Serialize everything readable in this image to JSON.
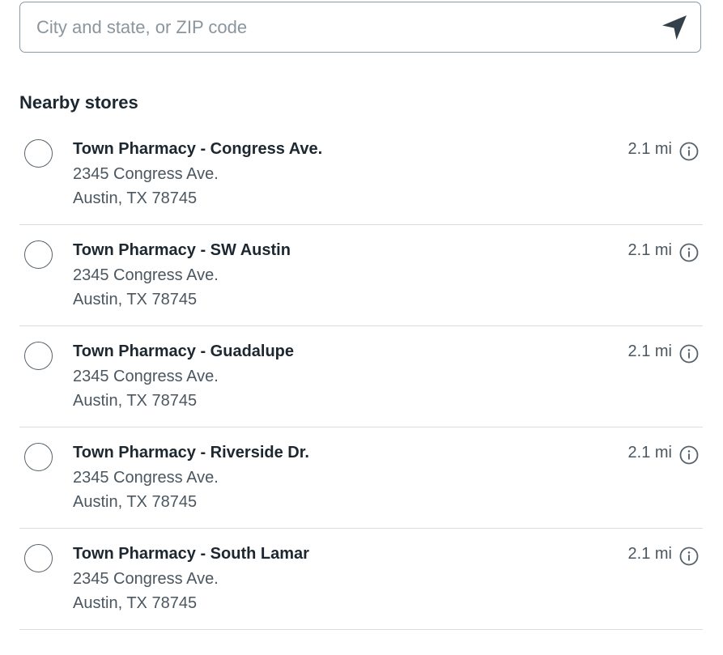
{
  "search": {
    "placeholder": "City and state, or ZIP code",
    "value": "",
    "locate_icon": "location-arrow-icon"
  },
  "nearby": {
    "title": "Nearby stores",
    "stores": [
      {
        "name": "Town Pharmacy - Congress Ave.",
        "address_line1": "2345 Congress Ave.",
        "address_line2": "Austin, TX 78745",
        "distance": "2.1 mi",
        "selected": false
      },
      {
        "name": "Town Pharmacy - SW Austin",
        "address_line1": "2345 Congress Ave.",
        "address_line2": "Austin, TX 78745",
        "distance": "2.1 mi",
        "selected": false
      },
      {
        "name": "Town Pharmacy - Guadalupe",
        "address_line1": "2345 Congress Ave.",
        "address_line2": "Austin, TX 78745",
        "distance": "2.1 mi",
        "selected": false
      },
      {
        "name": "Town Pharmacy - Riverside Dr.",
        "address_line1": "2345 Congress Ave.",
        "address_line2": "Austin, TX 78745",
        "distance": "2.1 mi",
        "selected": false
      },
      {
        "name": "Town Pharmacy - South Lamar",
        "address_line1": "2345 Congress Ave.",
        "address_line2": "Austin, TX 78745",
        "distance": "2.1 mi",
        "selected": false
      }
    ]
  },
  "colors": {
    "text_primary": "#1c2730",
    "text_secondary": "#4b5760",
    "border": "#8a99a3",
    "divider": "#d9dee2"
  }
}
